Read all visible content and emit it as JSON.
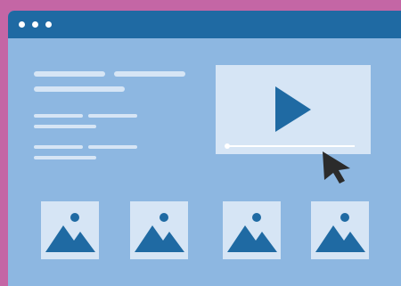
{
  "window": {
    "titlebar_dots": 3,
    "colors": {
      "page_background": "#c466a5",
      "window_body": "#8db7e1",
      "titlebar": "#1f6aa3",
      "placeholder": "#d6e5f5",
      "accent": "#1f6aa3",
      "cursor": "#2b2b2b"
    }
  },
  "text_placeholders": {
    "groups": 3
  },
  "video_player": {
    "icon": "play-icon",
    "progress": 0.0
  },
  "image_gallery": {
    "thumbnail_count": 4,
    "icon": "image-icon"
  },
  "cursor": {
    "icon": "mouse-pointer-icon"
  }
}
